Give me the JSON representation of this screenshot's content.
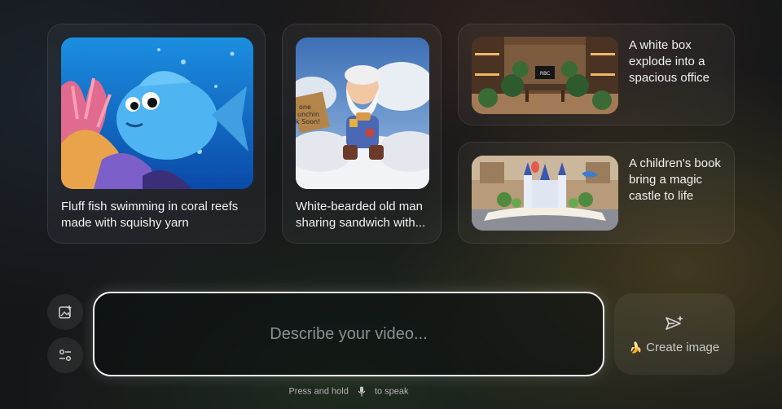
{
  "cards": [
    {
      "id": "fish",
      "caption": "Fluff fish swimming in coral reefs\nmade with squishy yarn"
    },
    {
      "id": "oldman",
      "caption": "White-bearded old man\nsharing sandwich with...",
      "sign_text": "one\nunchin\nk Soon!"
    },
    {
      "id": "office",
      "caption": "A white box\nexplode into a\nspacious office",
      "screen_text": "RBC"
    },
    {
      "id": "castle",
      "caption": "A children's book\nbring a magic\ncastle to life"
    }
  ],
  "prompt": {
    "placeholder": "Describe your video..."
  },
  "create_button": {
    "emoji": "🍌",
    "label": "Create image",
    "icon": "send-sparkle-icon"
  },
  "side_buttons": [
    {
      "icon": "add-image-icon"
    },
    {
      "icon": "settings-sliders-icon"
    }
  ],
  "hint": {
    "before": "Press and hold",
    "icon": "microphone-icon",
    "after": "to speak"
  }
}
